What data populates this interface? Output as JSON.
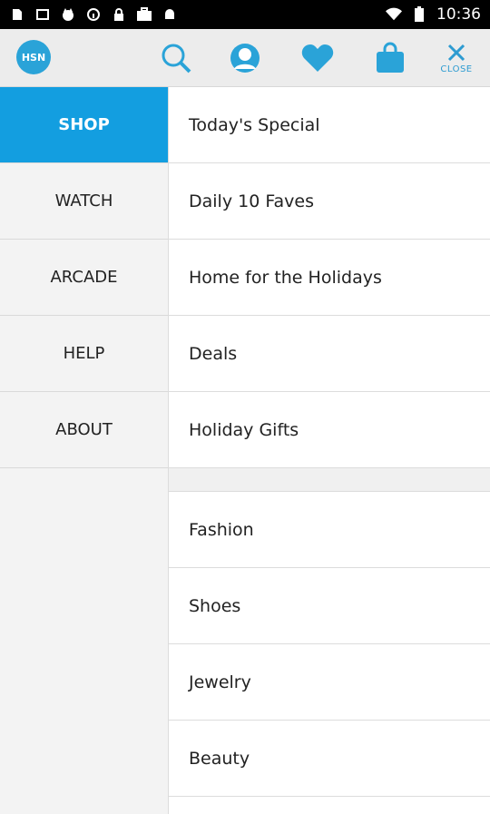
{
  "statusbar": {
    "time": "10:36",
    "left_icons": [
      "sim-icon",
      "image-icon",
      "cat-icon",
      "info-icon",
      "lock-icon",
      "briefcase-check-icon",
      "android-icon"
    ],
    "right_icons": [
      "wifi-icon",
      "battery-charging-icon"
    ]
  },
  "toolbar": {
    "logo_text": "HSN",
    "close_label": "CLOSE",
    "icons": [
      "search-icon",
      "account-icon",
      "heart-icon",
      "shopping-bag-icon"
    ],
    "accent": "#2aa3d8"
  },
  "sidebar": {
    "items": [
      {
        "label": "SHOP",
        "active": true
      },
      {
        "label": "WATCH",
        "active": false
      },
      {
        "label": "ARCADE",
        "active": false
      },
      {
        "label": "HELP",
        "active": false
      },
      {
        "label": "ABOUT",
        "active": false
      }
    ]
  },
  "menu": {
    "top_items": [
      "Today's Special",
      "Daily 10 Faves",
      "Home for the Holidays",
      "Deals",
      "Holiday Gifts"
    ],
    "category_items": [
      "Fashion",
      "Shoes",
      "Jewelry",
      "Beauty"
    ]
  },
  "colors": {
    "active_tab_bg": "#139ee0",
    "toolbar_bg": "#ececec",
    "sidebar_bg": "#f3f3f3"
  }
}
